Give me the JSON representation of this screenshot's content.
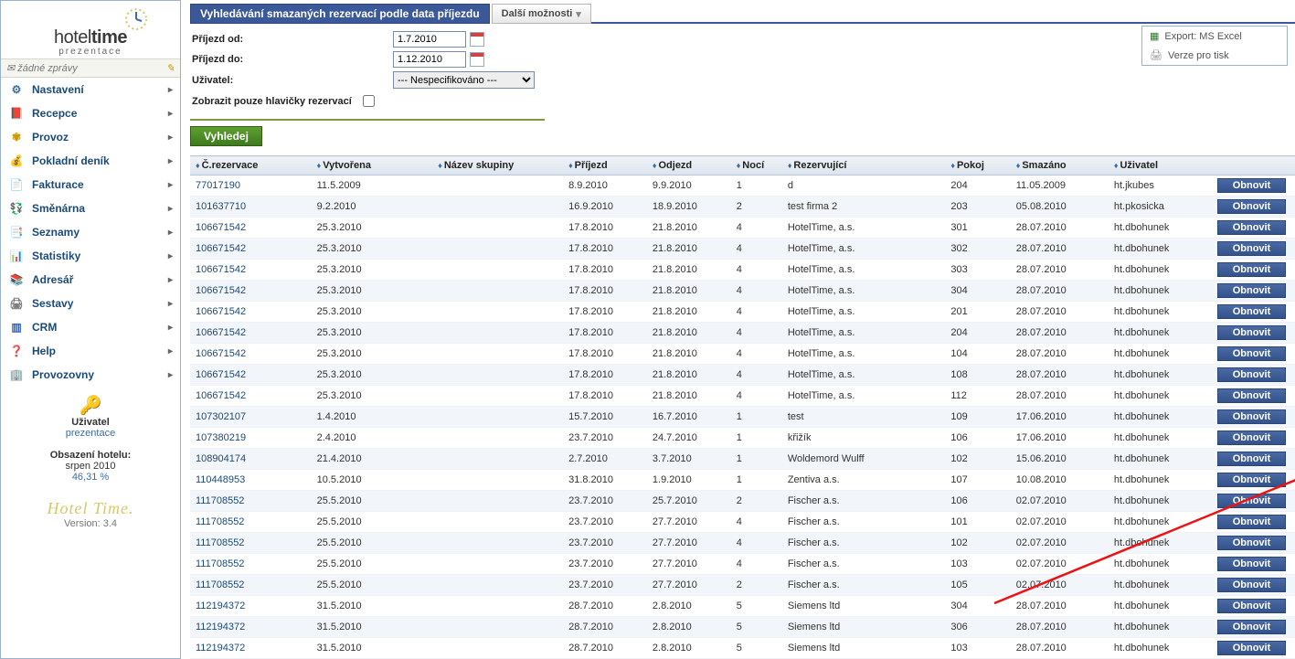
{
  "brand": {
    "name_a": "hotel",
    "name_b": "time",
    "sub": "prezentace"
  },
  "messages_bar": "žádné zprávy",
  "nav": [
    {
      "label": "Nastavení",
      "icon": "⚙",
      "color": "#3a6ea5"
    },
    {
      "label": "Recepce",
      "icon": "📕",
      "color": "#a23"
    },
    {
      "label": "Provoz",
      "icon": "✾",
      "color": "#c90"
    },
    {
      "label": "Pokladní deník",
      "icon": "💰",
      "color": "#b80"
    },
    {
      "label": "Fakturace",
      "icon": "📄",
      "color": "#36a"
    },
    {
      "label": "Směnárna",
      "icon": "💱",
      "color": "#c33"
    },
    {
      "label": "Seznamy",
      "icon": "📑",
      "color": "#888"
    },
    {
      "label": "Statistiky",
      "icon": "📊",
      "color": "#a33"
    },
    {
      "label": "Adresář",
      "icon": "📚",
      "color": "#833"
    },
    {
      "label": "Sestavy",
      "icon": "🖨",
      "color": "#777"
    },
    {
      "label": "CRM",
      "icon": "▥",
      "color": "#36a"
    },
    {
      "label": "Help",
      "icon": "❓",
      "color": "#c90"
    },
    {
      "label": "Provozovny",
      "icon": "🏢",
      "color": "#789"
    }
  ],
  "user_box": {
    "label": "Uživatel",
    "value": "prezentace"
  },
  "occupancy": {
    "line1": "Obsazení hotelu:",
    "line2": "srpen 2010",
    "pct": "46,31 %"
  },
  "version": "Version: 3.4",
  "page_title": "Vyhledávání smazaných rezervací podle data příjezdu",
  "tab_more": "Další možnosti",
  "export": {
    "excel": "Export: MS Excel",
    "print": "Verze pro tisk"
  },
  "filter": {
    "from_label": "Příjezd od:",
    "to_label": "Příjezd do:",
    "user_label": "Uživatel:",
    "headers_only_label": "Zobrazit pouze hlavičky rezervací",
    "from_value": "1.7.2010",
    "to_value": "1.12.2010",
    "user_value": "--- Nespecifikováno ---",
    "search_btn": "Vyhledej"
  },
  "columns": [
    "Č.rezervace",
    "Vytvořena",
    "Název skupiny",
    "Příjezd",
    "Odjezd",
    "Nocí",
    "Rezervující",
    "Pokoj",
    "Smazáno",
    "Uživatel",
    ""
  ],
  "restore_label": "Obnovit",
  "rows": [
    {
      "res": "77017190",
      "created": "11.5.2009",
      "group": "",
      "arr": "8.9.2010",
      "dep": "9.9.2010",
      "n": "1",
      "by": "d",
      "room": "204",
      "del": "11.05.2009",
      "user": "ht.jkubes"
    },
    {
      "res": "101637710",
      "created": "9.2.2010",
      "group": "",
      "arr": "16.9.2010",
      "dep": "18.9.2010",
      "n": "2",
      "by": "test firma 2",
      "room": "203",
      "del": "05.08.2010",
      "user": "ht.pkosicka"
    },
    {
      "res": "106671542",
      "created": "25.3.2010",
      "group": "",
      "arr": "17.8.2010",
      "dep": "21.8.2010",
      "n": "4",
      "by": "HotelTime, a.s.",
      "room": "301",
      "del": "28.07.2010",
      "user": "ht.dbohunek"
    },
    {
      "res": "106671542",
      "created": "25.3.2010",
      "group": "",
      "arr": "17.8.2010",
      "dep": "21.8.2010",
      "n": "4",
      "by": "HotelTime, a.s.",
      "room": "302",
      "del": "28.07.2010",
      "user": "ht.dbohunek"
    },
    {
      "res": "106671542",
      "created": "25.3.2010",
      "group": "",
      "arr": "17.8.2010",
      "dep": "21.8.2010",
      "n": "4",
      "by": "HotelTime, a.s.",
      "room": "303",
      "del": "28.07.2010",
      "user": "ht.dbohunek"
    },
    {
      "res": "106671542",
      "created": "25.3.2010",
      "group": "",
      "arr": "17.8.2010",
      "dep": "21.8.2010",
      "n": "4",
      "by": "HotelTime, a.s.",
      "room": "304",
      "del": "28.07.2010",
      "user": "ht.dbohunek"
    },
    {
      "res": "106671542",
      "created": "25.3.2010",
      "group": "",
      "arr": "17.8.2010",
      "dep": "21.8.2010",
      "n": "4",
      "by": "HotelTime, a.s.",
      "room": "201",
      "del": "28.07.2010",
      "user": "ht.dbohunek"
    },
    {
      "res": "106671542",
      "created": "25.3.2010",
      "group": "",
      "arr": "17.8.2010",
      "dep": "21.8.2010",
      "n": "4",
      "by": "HotelTime, a.s.",
      "room": "204",
      "del": "28.07.2010",
      "user": "ht.dbohunek"
    },
    {
      "res": "106671542",
      "created": "25.3.2010",
      "group": "",
      "arr": "17.8.2010",
      "dep": "21.8.2010",
      "n": "4",
      "by": "HotelTime, a.s.",
      "room": "104",
      "del": "28.07.2010",
      "user": "ht.dbohunek"
    },
    {
      "res": "106671542",
      "created": "25.3.2010",
      "group": "",
      "arr": "17.8.2010",
      "dep": "21.8.2010",
      "n": "4",
      "by": "HotelTime, a.s.",
      "room": "108",
      "del": "28.07.2010",
      "user": "ht.dbohunek"
    },
    {
      "res": "106671542",
      "created": "25.3.2010",
      "group": "",
      "arr": "17.8.2010",
      "dep": "21.8.2010",
      "n": "4",
      "by": "HotelTime, a.s.",
      "room": "112",
      "del": "28.07.2010",
      "user": "ht.dbohunek"
    },
    {
      "res": "107302107",
      "created": "1.4.2010",
      "group": "",
      "arr": "15.7.2010",
      "dep": "16.7.2010",
      "n": "1",
      "by": "test",
      "room": "109",
      "del": "17.06.2010",
      "user": "ht.dbohunek"
    },
    {
      "res": "107380219",
      "created": "2.4.2010",
      "group": "",
      "arr": "23.7.2010",
      "dep": "24.7.2010",
      "n": "1",
      "by": "křižík",
      "room": "106",
      "del": "17.06.2010",
      "user": "ht.dbohunek"
    },
    {
      "res": "108904174",
      "created": "21.4.2010",
      "group": "",
      "arr": "2.7.2010",
      "dep": "3.7.2010",
      "n": "1",
      "by": "Woldemord Wulff",
      "room": "102",
      "del": "15.06.2010",
      "user": "ht.dbohunek"
    },
    {
      "res": "110448953",
      "created": "10.5.2010",
      "group": "",
      "arr": "31.8.2010",
      "dep": "1.9.2010",
      "n": "1",
      "by": "Zentiva a.s.",
      "room": "107",
      "del": "10.08.2010",
      "user": "ht.dbohunek"
    },
    {
      "res": "111708552",
      "created": "25.5.2010",
      "group": "",
      "arr": "23.7.2010",
      "dep": "25.7.2010",
      "n": "2",
      "by": "Fischer a.s.",
      "room": "106",
      "del": "02.07.2010",
      "user": "ht.dbohunek"
    },
    {
      "res": "111708552",
      "created": "25.5.2010",
      "group": "",
      "arr": "23.7.2010",
      "dep": "27.7.2010",
      "n": "4",
      "by": "Fischer a.s.",
      "room": "101",
      "del": "02.07.2010",
      "user": "ht.dbohunek"
    },
    {
      "res": "111708552",
      "created": "25.5.2010",
      "group": "",
      "arr": "23.7.2010",
      "dep": "27.7.2010",
      "n": "4",
      "by": "Fischer a.s.",
      "room": "102",
      "del": "02.07.2010",
      "user": "ht.dbohunek"
    },
    {
      "res": "111708552",
      "created": "25.5.2010",
      "group": "",
      "arr": "23.7.2010",
      "dep": "27.7.2010",
      "n": "4",
      "by": "Fischer a.s.",
      "room": "103",
      "del": "02.07.2010",
      "user": "ht.dbohunek"
    },
    {
      "res": "111708552",
      "created": "25.5.2010",
      "group": "",
      "arr": "23.7.2010",
      "dep": "27.7.2010",
      "n": "2",
      "by": "Fischer a.s.",
      "room": "105",
      "del": "02.07.2010",
      "user": "ht.dbohunek"
    },
    {
      "res": "112194372",
      "created": "31.5.2010",
      "group": "",
      "arr": "28.7.2010",
      "dep": "2.8.2010",
      "n": "5",
      "by": "Siemens ltd",
      "room": "304",
      "del": "28.07.2010",
      "user": "ht.dbohunek"
    },
    {
      "res": "112194372",
      "created": "31.5.2010",
      "group": "",
      "arr": "28.7.2010",
      "dep": "2.8.2010",
      "n": "5",
      "by": "Siemens ltd",
      "room": "306",
      "del": "28.07.2010",
      "user": "ht.dbohunek"
    },
    {
      "res": "112194372",
      "created": "31.5.2010",
      "group": "",
      "arr": "28.7.2010",
      "dep": "2.8.2010",
      "n": "5",
      "by": "Siemens ltd",
      "room": "103",
      "del": "28.07.2010",
      "user": "ht.dbohunek"
    }
  ]
}
